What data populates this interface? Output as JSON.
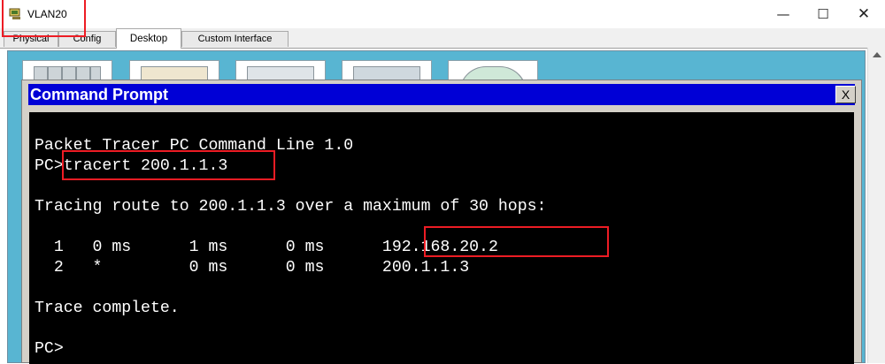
{
  "window": {
    "title": "VLAN20",
    "icon": "packet-tracer-pc-icon",
    "controls": {
      "minimize": "—",
      "maximize": "☐",
      "close": "✕"
    }
  },
  "tabs": [
    {
      "label": "Physical",
      "active": false
    },
    {
      "label": "Config",
      "active": false
    },
    {
      "label": "Desktop",
      "active": true
    },
    {
      "label": "Custom Interface",
      "active": false
    }
  ],
  "command_prompt": {
    "title": "Command Prompt",
    "close_label": "X",
    "lines": [
      "Packet Tracer PC Command Line 1.0",
      "PC>tracert 200.1.1.3",
      "Tracing route to 200.1.1.3 over a maximum of 30 hops:",
      "  1   0 ms      1 ms      0 ms      192.168.20.2",
      "  2   *         0 ms      0 ms      200.1.1.3",
      "Trace complete.",
      "PC>"
    ]
  },
  "colors": {
    "desktop_background": "#58b5d2",
    "cmd_titlebar": "#0000d6",
    "terminal_background": "#000000",
    "terminal_text": "#ffffff",
    "highlight": "#ed1c24"
  }
}
